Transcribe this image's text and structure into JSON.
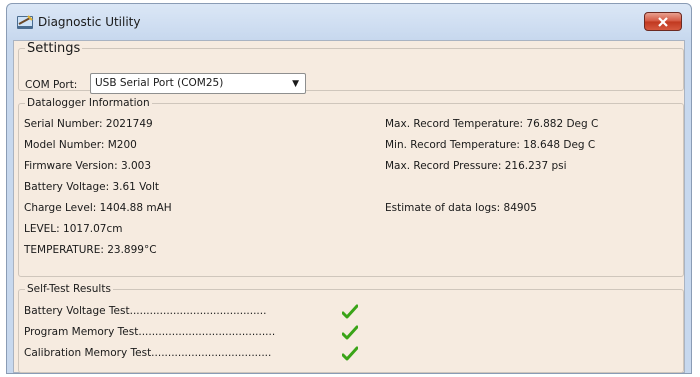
{
  "window": {
    "title": "Diagnostic Utility"
  },
  "settings": {
    "legend": "Settings",
    "com_port_label": "COM Port:",
    "com_port_value": "USB Serial Port (COM25)"
  },
  "datalogger": {
    "legend": "Datalogger Information",
    "left": [
      "Serial Number: 2021749",
      "Model Number: M200",
      "Firmware Version: 3.003",
      "Battery Voltage: 3.61 Volt",
      "Charge Level: 1404.88 mAH",
      "LEVEL: 1017.07cm",
      "TEMPERATURE: 23.899°C"
    ],
    "right": [
      "Max. Record Temperature: 76.882 Deg C",
      "Min. Record Temperature: 18.648 Deg C",
      "Max. Record Pressure: 216.237 psi",
      "Estimate of data logs: 84905"
    ]
  },
  "selftest": {
    "legend": "Self-Test Results",
    "items": [
      {
        "label": "Battery Voltage Test.........................................",
        "passed": true
      },
      {
        "label": "Program Memory Test.........................................",
        "passed": true
      },
      {
        "label": "Calibration Memory Test....................................",
        "passed": true
      }
    ]
  },
  "colors": {
    "client_bg": "#f6ebe0",
    "check_green": "#3aa418",
    "close_red": "#c7452c"
  },
  "icons": {
    "app": "diagnostic-tool-icon",
    "close": "close-icon",
    "dropdown": "chevron-down-icon",
    "pass": "checkmark-icon"
  }
}
